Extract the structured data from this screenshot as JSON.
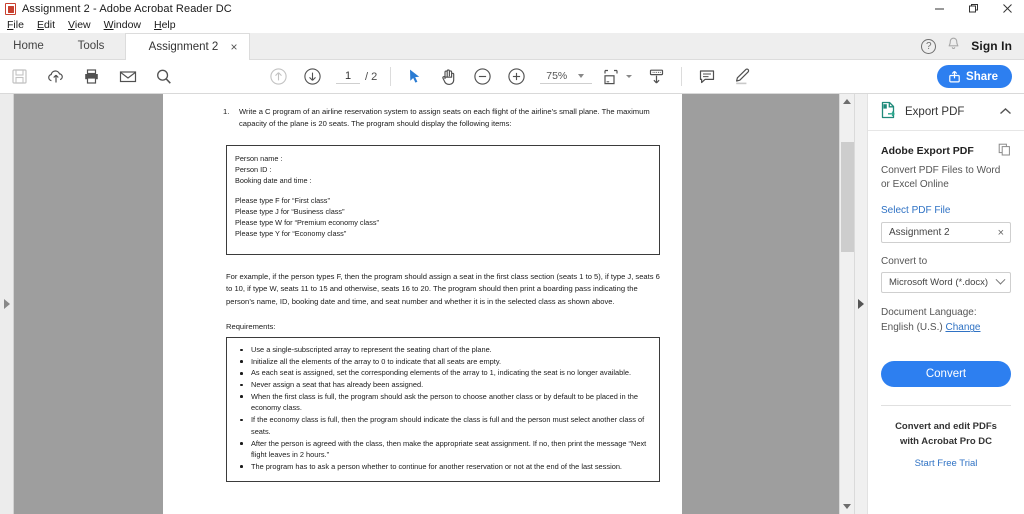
{
  "window": {
    "title": "Assignment 2 - Adobe Acrobat Reader DC",
    "app_icon": "pdf-icon",
    "minimize": "minimize-icon",
    "restore": "restore-icon",
    "close": "close-icon"
  },
  "menubar": {
    "items": [
      {
        "label": "File",
        "accel": "F"
      },
      {
        "label": "Edit",
        "accel": "E"
      },
      {
        "label": "View",
        "accel": "V"
      },
      {
        "label": "Window",
        "accel": "W"
      },
      {
        "label": "Help",
        "accel": "H"
      }
    ]
  },
  "tabs": {
    "home": "Home",
    "tools": "Tools",
    "document": "Assignment 2",
    "close_glyph": "×",
    "help_glyph": "?",
    "bell": "bell-icon",
    "signin": "Sign In"
  },
  "toolbar": {
    "left_icons": [
      "save-icon",
      "upload-cloud-icon",
      "print-icon",
      "email-icon",
      "search-icon"
    ],
    "prev_page": "previous-page-icon",
    "next_page": "next-page-icon",
    "page_current": "1",
    "page_total": "/ 2",
    "select_tool": "cursor-select-icon",
    "hand_tool": "hand-tool-icon",
    "zoom_out": "zoom-out-icon",
    "zoom_in": "zoom-in-icon",
    "zoom_level": "75%",
    "fit_page": "fit-page-icon",
    "scroll_mode": "scroll-mode-icon",
    "comment": "comment-icon",
    "highlight": "highlight-icon",
    "share": "Share"
  },
  "document": {
    "item_number": "1.",
    "intro": "Write a C program of an airline reservation system to assign seats on each flight of the airline’s small plane. The maximum capacity of the plane is 20 seats. The program should display the following items:",
    "code_lines_top": [
      "Person name :",
      "Person ID :",
      "Booking date and time :"
    ],
    "code_lines_bottom": [
      "Please type F for “First class”",
      "Please type J for “Business class”",
      "Please type W for “Premium economy class”",
      "Please type Y for “Economy class”"
    ],
    "example_paragraph": "For example, if the person types F, then the program should assign a seat in the first class section (seats 1 to 5), if type J, seats 6 to 10, if type W, seats 11 to 15 and otherwise, seats 16 to 20. The program should then print a boarding pass indicating the person’s name, ID, booking date and time, and seat number and whether it is in the selected class as shown above.",
    "requirements_label": "Requirements:",
    "requirements": [
      "Use a single-subscripted array to represent the seating chart of the plane.",
      "Initialize all the elements of the array to 0 to indicate that all seats are empty.",
      "As each seat is assigned, set the corresponding elements of the array to 1, indicating the seat is no longer available.",
      "Never assign a seat that has already been assigned.",
      "When the first class is full, the program should ask the person to choose another class or by default to be placed in the economy class.",
      "If the economy class is full, then the program should indicate the class is full and the person must select another class of seats.",
      "After the person is agreed with the class, then make the appropriate seat assignment. If no, then print the message “Next flight leaves in 2 hours.”",
      "The program has to ask a person whether to continue for another reservation or not at the end of the last session."
    ]
  },
  "right_panel": {
    "header_title": "Export PDF",
    "header_icon": "export-pdf-icon",
    "collapse_icon": "chevron-up-icon",
    "heading": "Adobe Export PDF",
    "copy_icon": "copy-icon",
    "subtitle": "Convert PDF Files to Word or Excel Online",
    "select_file_link": "Select PDF File",
    "file_value": "Assignment 2",
    "file_clear": "×",
    "convert_to_label": "Convert to",
    "format_value": "Microsoft Word (*.docx)",
    "doc_language_label": "Document Language:",
    "doc_language_value": "English (U.S.)",
    "change_link": "Change",
    "convert_button": "Convert",
    "footer_title": "Convert and edit PDFs with Acrobat Pro DC",
    "footer_link": "Start Free Trial"
  },
  "colors": {
    "accent_blue": "#2d7ff0",
    "link_blue": "#2f72c4",
    "export_teal": "#1f8a7a",
    "doc_bg": "#9e9e9e",
    "pdf_red": "#c8402f"
  }
}
